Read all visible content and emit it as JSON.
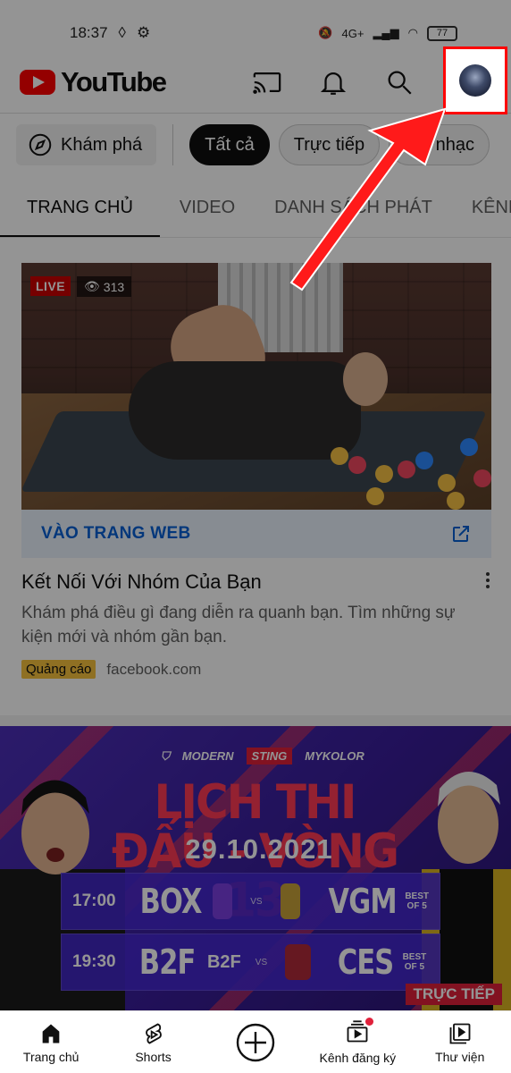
{
  "status_bar": {
    "time": "18:37",
    "network": "4G+",
    "battery": "77"
  },
  "app_bar": {
    "logo_text": "YouTube"
  },
  "chips": {
    "explore": "Khám phá",
    "items": [
      "Tất cả",
      "Trực tiếp",
      "Âm nhạc"
    ]
  },
  "tabs": [
    "TRANG CHỦ",
    "VIDEO",
    "DANH SÁCH PHÁT",
    "KÊNH"
  ],
  "ad": {
    "live_label": "LIVE",
    "viewer_count": "313",
    "cta_label": "VÀO TRANG WEB",
    "title": "Kết Nối Với Nhóm Của Bạn",
    "description": "Khám phá điều gì đang diễn ra quanh bạn. Tìm những sự kiện mới và nhóm gần bạn.",
    "badge": "Quảng cáo",
    "domain": "facebook.com"
  },
  "banner": {
    "sponsors": [
      "MODERN",
      "STING",
      "MYKOLOR"
    ],
    "headline": "LỊCH THI ĐẤU - VÒNG 13",
    "date": "29.10.2021",
    "matches": [
      {
        "time": "17:00",
        "team_a": "BOX",
        "vs": "VS",
        "team_b": "VGM",
        "format": "BEST OF 5"
      },
      {
        "time": "19:30",
        "team_a": "B2F",
        "team_a_sub": "B2F",
        "vs": "VS",
        "team_b": "CES",
        "format": "BEST OF 5"
      }
    ],
    "live_tag": "TRỰC TIẾP"
  },
  "bottom_nav": {
    "items": [
      {
        "label": "Trang chủ",
        "icon": "home-icon"
      },
      {
        "label": "Shorts",
        "icon": "shorts-icon"
      },
      {
        "label": "",
        "icon": "create-icon"
      },
      {
        "label": "Kênh đăng ký",
        "icon": "subscriptions-icon"
      },
      {
        "label": "Thư viện",
        "icon": "library-icon"
      }
    ]
  },
  "colors": {
    "brand_red": "#ff0000",
    "link_blue": "#065fd4",
    "ad_badge": "#f7c23d",
    "annotation": "#ff0000"
  }
}
